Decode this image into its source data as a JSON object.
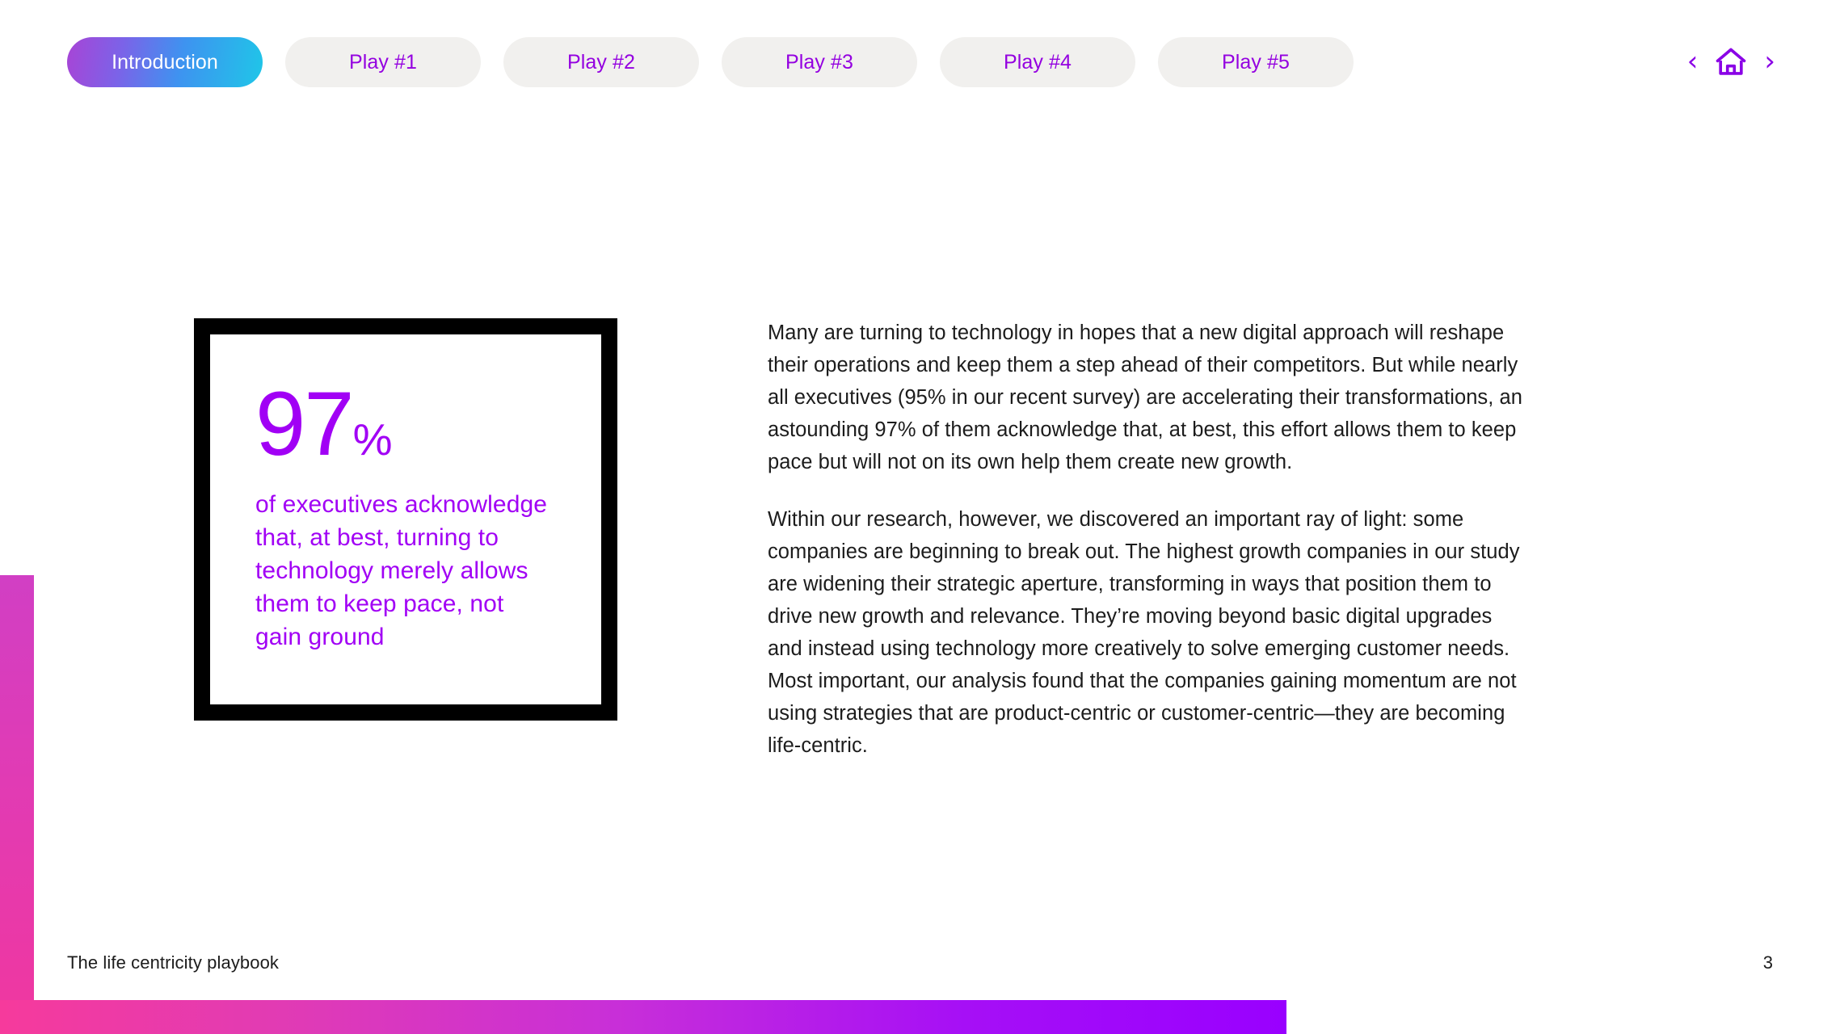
{
  "document": {
    "footer_title": "The life centricity playbook",
    "page_number": "3"
  },
  "tabbar": {
    "tabs": [
      {
        "label": "Introduction",
        "active": true
      },
      {
        "label": "Play #1",
        "active": false
      },
      {
        "label": "Play #2",
        "active": false
      },
      {
        "label": "Play #3",
        "active": false
      },
      {
        "label": "Play #4",
        "active": false
      },
      {
        "label": "Play #5",
        "active": false
      }
    ],
    "nav": {
      "prev_label": "‹",
      "next_label": "›",
      "home_icon": "home-icon"
    }
  },
  "stat_card": {
    "number": "97",
    "percent_symbol": "%",
    "caption": "of executives acknowledge that, at best, turning to technology merely allows them to keep pace, not gain ground"
  },
  "main": {
    "paragraphs": [
      "Many are turning to technology in hopes that a new digital approach will reshape their operations and keep them a step ahead of their competitors. But while nearly all executives (95% in our recent survey) are accelerating their transformations, an astounding 97% of them acknowledge that, at best, this effort allows them to keep pace but will not on its own help them create new growth.",
      "Within our research, however, we discovered an important ray of light: some companies are beginning to break out. The highest growth companies in our study are widening their strategic aperture, transforming in ways that position them to drive new growth and relevance. They’re moving beyond basic digital upgrades and instead using technology more creatively to solve emerging customer needs. Most important, our analysis found that the companies gaining momentum are not using strategies that are product-centric or customer-centric—they are becoming life-centric."
    ]
  },
  "colors": {
    "accent_purple": "#a100f5",
    "tab_inactive_bg": "#f1f0ee",
    "tab_text_purple": "#9400e0",
    "bar_pink": "#f63a9c",
    "bar_purple": "#9900ff",
    "text": "#1c1c1c"
  }
}
